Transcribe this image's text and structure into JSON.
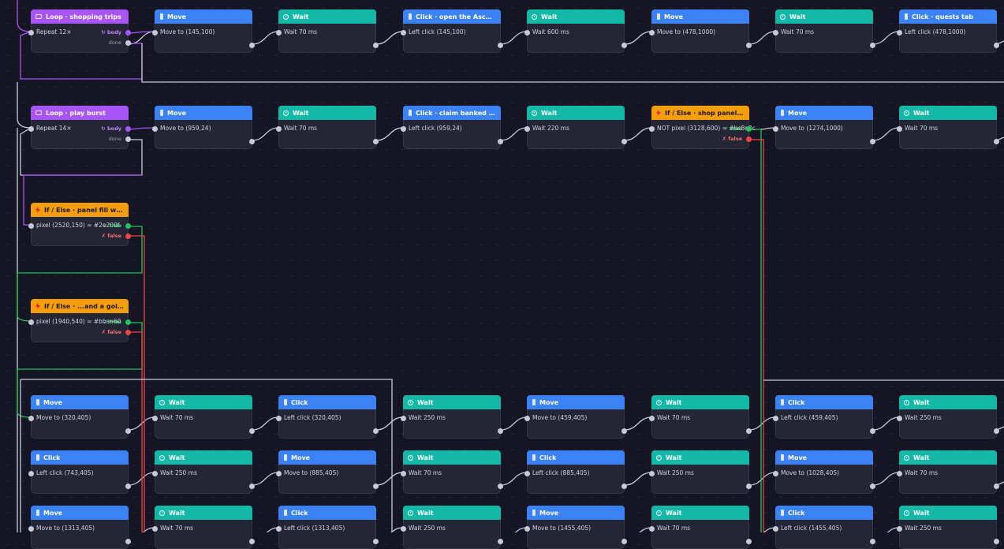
{
  "nodes": [
    {
      "id": "r0c0",
      "kind": "loop",
      "header": "Loop · shopping trips",
      "body": "Repeat 12×",
      "body_port": "↻ body",
      "done_port": "done"
    },
    {
      "id": "r0c1",
      "kind": "move",
      "header": "Move",
      "body": "Move to (145,100)"
    },
    {
      "id": "r0c2",
      "kind": "wait",
      "header": "Wait",
      "body": "Wait 70 ms"
    },
    {
      "id": "r0c3",
      "kind": "click",
      "header": "Click · open the Ascens...",
      "body": "Left click (145,100)"
    },
    {
      "id": "r0c4",
      "kind": "wait",
      "header": "Wait",
      "body": "Wait 600 ms"
    },
    {
      "id": "r0c5",
      "kind": "move",
      "header": "Move",
      "body": "Move to (478,1000)"
    },
    {
      "id": "r0c6",
      "kind": "wait",
      "header": "Wait",
      "body": "Wait 70 ms"
    },
    {
      "id": "r0c7",
      "kind": "click",
      "header": "Click · quests tab",
      "body": "Left click (478,1000)"
    },
    {
      "id": "r1c0",
      "kind": "loop",
      "header": "Loop · play burst",
      "body": "Repeat 14×",
      "body_port": "↻ body",
      "done_port": "done"
    },
    {
      "id": "r1c1",
      "kind": "move",
      "header": "Move",
      "body": "Move to (959,24)"
    },
    {
      "id": "r1c2",
      "kind": "wait",
      "header": "Wait",
      "body": "Wait 70 ms"
    },
    {
      "id": "r1c3",
      "kind": "click",
      "header": "Click · claim banked ra...",
      "body": "Left click (959,24)"
    },
    {
      "id": "r1c4",
      "kind": "wait",
      "header": "Wait",
      "body": "Wait 220 ms"
    },
    {
      "id": "r1c5",
      "kind": "if",
      "header": "If / Else · shop panel go...",
      "body": "NOT pixel (3128,600) ≈ #bc8e3c",
      "true_port": "✓ true",
      "false_port": "✗ false"
    },
    {
      "id": "r1c6",
      "kind": "move",
      "header": "Move",
      "body": "Move to (1274,1000)"
    },
    {
      "id": "r1c7",
      "kind": "wait",
      "header": "Wait",
      "body": "Wait 70 ms"
    },
    {
      "id": "if1",
      "kind": "if",
      "header": "If / Else · panel fill whe...",
      "body": "pixel (2520,150) ≈ #2e200f",
      "true_port": "✓ true",
      "false_port": "✗ false"
    },
    {
      "id": "if2",
      "kind": "if",
      "header": "If / Else · ...and a gold fr...",
      "body": "pixel (1940,540) ≈ #bbaa60",
      "true_port": "✓ true",
      "false_port": "✗ false"
    },
    {
      "id": "g0c0",
      "kind": "move",
      "header": "Move",
      "body": "Move to (320,405)"
    },
    {
      "id": "g0c1",
      "kind": "wait",
      "header": "Wait",
      "body": "Wait 70 ms"
    },
    {
      "id": "g0c2",
      "kind": "click",
      "header": "Click",
      "body": "Left click (320,405)"
    },
    {
      "id": "g0c3",
      "kind": "wait",
      "header": "Wait",
      "body": "Wait 250 ms"
    },
    {
      "id": "g0c4",
      "kind": "move",
      "header": "Move",
      "body": "Move to (459,405)"
    },
    {
      "id": "g0c5",
      "kind": "wait",
      "header": "Wait",
      "body": "Wait 70 ms"
    },
    {
      "id": "g0c6",
      "kind": "click",
      "header": "Click",
      "body": "Left click (459,405)"
    },
    {
      "id": "g0c7",
      "kind": "wait",
      "header": "Wait",
      "body": "Wait 250 ms"
    },
    {
      "id": "g1c0",
      "kind": "click",
      "header": "Click",
      "body": "Left click (743,405)"
    },
    {
      "id": "g1c1",
      "kind": "wait",
      "header": "Wait",
      "body": "Wait 250 ms"
    },
    {
      "id": "g1c2",
      "kind": "move",
      "header": "Move",
      "body": "Move to (885,405)"
    },
    {
      "id": "g1c3",
      "kind": "wait",
      "header": "Wait",
      "body": "Wait 70 ms"
    },
    {
      "id": "g1c4",
      "kind": "click",
      "header": "Click",
      "body": "Left click (885,405)"
    },
    {
      "id": "g1c5",
      "kind": "wait",
      "header": "Wait",
      "body": "Wait 250 ms"
    },
    {
      "id": "g1c6",
      "kind": "move",
      "header": "Move",
      "body": "Move to (1028,405)"
    },
    {
      "id": "g1c7",
      "kind": "wait",
      "header": "Wait",
      "body": "Wait 70 ms"
    },
    {
      "id": "g2c0",
      "kind": "move",
      "header": "Move",
      "body": "Move to (1313,405)"
    },
    {
      "id": "g2c1",
      "kind": "wait",
      "header": "Wait",
      "body": "Wait 70 ms"
    },
    {
      "id": "g2c2",
      "kind": "click",
      "header": "Click",
      "body": "Left click (1313,405)"
    },
    {
      "id": "g2c3",
      "kind": "wait",
      "header": "Wait",
      "body": "Wait 250 ms"
    },
    {
      "id": "g2c4",
      "kind": "move",
      "header": "Move",
      "body": "Move to (1455,405)"
    },
    {
      "id": "g2c5",
      "kind": "wait",
      "header": "Wait",
      "body": "Wait 70 ms"
    },
    {
      "id": "g2c6",
      "kind": "click",
      "header": "Click",
      "body": "Left click (1455,405)"
    },
    {
      "id": "g2c7",
      "kind": "wait",
      "header": "Wait",
      "body": "Wait 250 ms"
    }
  ],
  "icons": {
    "move": "cursor-bar-icon",
    "click": "cursor-bar-icon",
    "wait": "stopwatch-icon",
    "loop": "loop-icon",
    "if": "lightning-icon"
  },
  "colors": {
    "move": "#3b82f6",
    "click": "#3b82f6",
    "wait": "#14b8a6",
    "loop": "#a855f7",
    "if": "#f59e0b",
    "wire": "#c6c9d6",
    "wire_true": "#22c55e",
    "wire_false": "#ef4444",
    "wire_loop": "#a855f7",
    "canvas": "#151523"
  }
}
